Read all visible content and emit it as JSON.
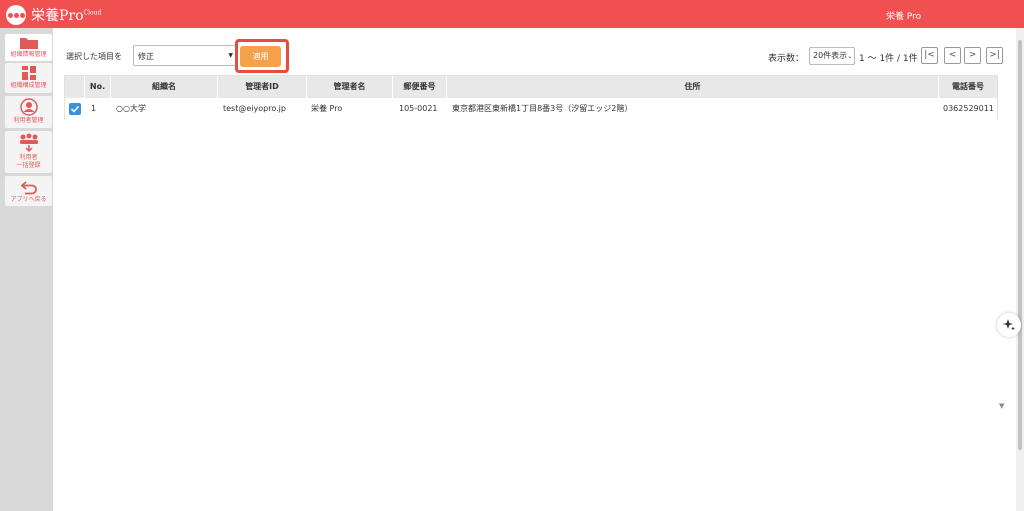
{
  "app": {
    "logo_text": "栄養Pro",
    "logo_sup": "Cloud",
    "user_name": "栄養 Pro"
  },
  "sidebar": {
    "items": [
      {
        "label": "組織情報管理",
        "icon": "folder-icon"
      },
      {
        "label": "組織構成管理",
        "icon": "grid-icon"
      },
      {
        "label": "利用者管理",
        "icon": "user-icon"
      },
      {
        "label_line1": "利用者",
        "label_line2": "一括登録",
        "icon": "group-upload-icon"
      },
      {
        "label": "アプリへ戻る",
        "icon": "return-icon"
      }
    ]
  },
  "toolbar": {
    "select_label": "選択した項目を",
    "action_value": "修正",
    "apply_label": "適用",
    "display_count_label": "表示数：",
    "display_count_value": "20件表示",
    "range_text": "1 〜 1件 / 1件",
    "pager": {
      "first": "|<",
      "prev": "<",
      "next": ">",
      "last": ">|"
    }
  },
  "table": {
    "headers": [
      "No.",
      "組織名",
      "管理者ID",
      "管理者名",
      "郵便番号",
      "住所",
      "電話番号"
    ],
    "rows": [
      {
        "no": "1",
        "org": "○○大学",
        "admin_id": "test@eiyopro.jp",
        "admin_name": "栄養 Pro",
        "zip": "105-0021",
        "address": "東京都港区東新橋1丁目8番3号（汐留エッジ2階）",
        "phone": "0362529011"
      }
    ]
  },
  "colors": {
    "brand": "#f05050",
    "apply": "#f5a04a",
    "highlight": "#e74c3c",
    "checkbox": "#3b8fe0"
  }
}
